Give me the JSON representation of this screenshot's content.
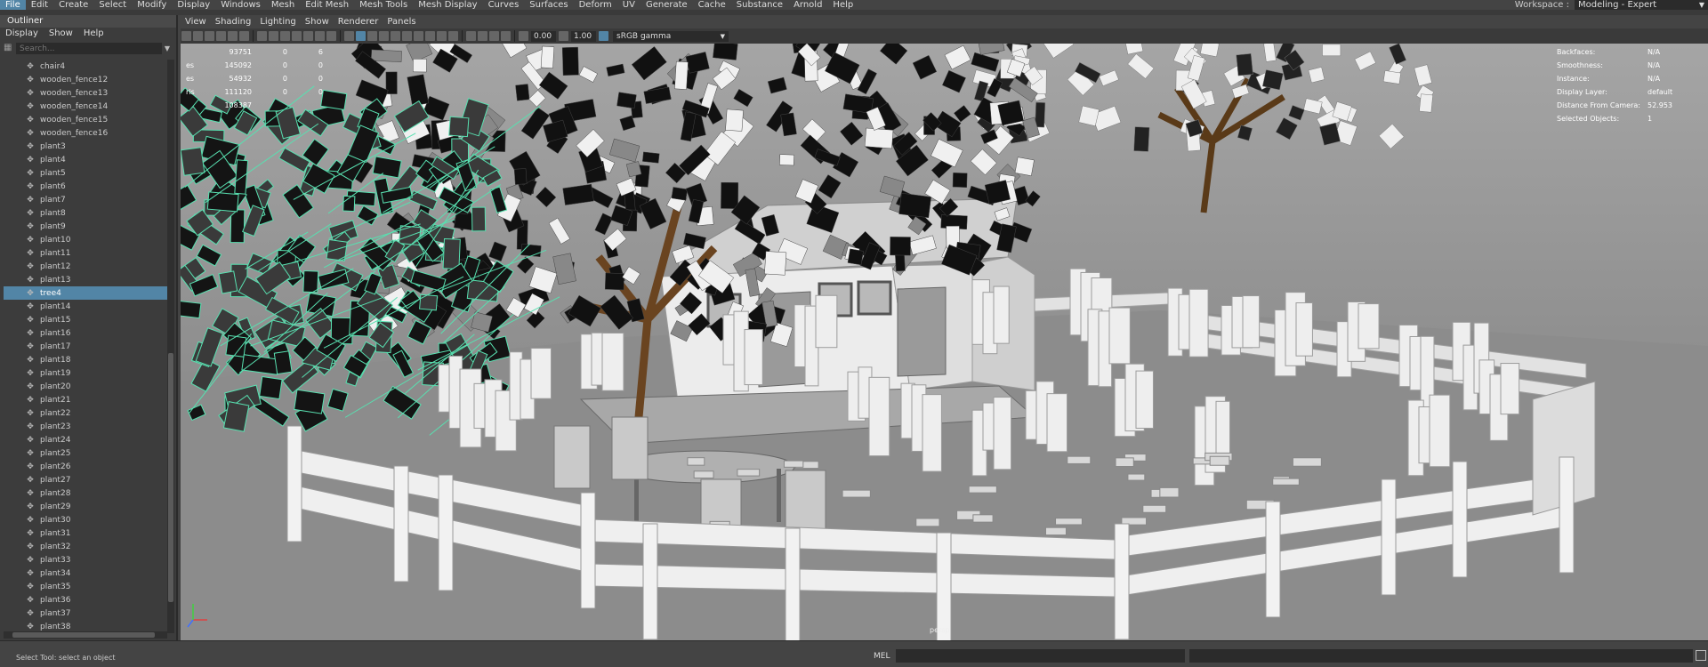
{
  "menubar": {
    "items": [
      "File",
      "Edit",
      "Create",
      "Select",
      "Modify",
      "Display",
      "Windows",
      "Mesh",
      "Edit Mesh",
      "Mesh Tools",
      "Mesh Display",
      "Curves",
      "Surfaces",
      "Deform",
      "UV",
      "Generate",
      "Cache",
      "Substance",
      "Arnold",
      "Help"
    ],
    "active": "File"
  },
  "workspace": {
    "label": "Workspace :",
    "value": "Modeling - Expert"
  },
  "outliner": {
    "title": "Outliner",
    "menu": [
      "Display",
      "Show",
      "Help"
    ],
    "search_placeholder": "Search...",
    "items": [
      {
        "name": "chair4",
        "selected": false
      },
      {
        "name": "wooden_fence12",
        "selected": false
      },
      {
        "name": "wooden_fence13",
        "selected": false
      },
      {
        "name": "wooden_fence14",
        "selected": false
      },
      {
        "name": "wooden_fence15",
        "selected": false
      },
      {
        "name": "wooden_fence16",
        "selected": false
      },
      {
        "name": "plant3",
        "selected": false
      },
      {
        "name": "plant4",
        "selected": false
      },
      {
        "name": "plant5",
        "selected": false
      },
      {
        "name": "plant6",
        "selected": false
      },
      {
        "name": "plant7",
        "selected": false
      },
      {
        "name": "plant8",
        "selected": false
      },
      {
        "name": "plant9",
        "selected": false
      },
      {
        "name": "plant10",
        "selected": false
      },
      {
        "name": "plant11",
        "selected": false
      },
      {
        "name": "plant12",
        "selected": false
      },
      {
        "name": "plant13",
        "selected": false
      },
      {
        "name": "tree4",
        "selected": true
      },
      {
        "name": "plant14",
        "selected": false
      },
      {
        "name": "plant15",
        "selected": false
      },
      {
        "name": "plant16",
        "selected": false
      },
      {
        "name": "plant17",
        "selected": false
      },
      {
        "name": "plant18",
        "selected": false
      },
      {
        "name": "plant19",
        "selected": false
      },
      {
        "name": "plant20",
        "selected": false
      },
      {
        "name": "plant21",
        "selected": false
      },
      {
        "name": "plant22",
        "selected": false
      },
      {
        "name": "plant23",
        "selected": false
      },
      {
        "name": "plant24",
        "selected": false
      },
      {
        "name": "plant25",
        "selected": false
      },
      {
        "name": "plant26",
        "selected": false
      },
      {
        "name": "plant27",
        "selected": false
      },
      {
        "name": "plant28",
        "selected": false
      },
      {
        "name": "plant29",
        "selected": false
      },
      {
        "name": "plant30",
        "selected": false
      },
      {
        "name": "plant31",
        "selected": false
      },
      {
        "name": "plant32",
        "selected": false
      },
      {
        "name": "plant33",
        "selected": false
      },
      {
        "name": "plant34",
        "selected": false
      },
      {
        "name": "plant35",
        "selected": false
      },
      {
        "name": "plant36",
        "selected": false
      },
      {
        "name": "plant37",
        "selected": false
      },
      {
        "name": "plant38",
        "selected": false
      }
    ]
  },
  "viewport": {
    "menu": [
      "View",
      "Shading",
      "Lighting",
      "Show",
      "Renderer",
      "Panels"
    ],
    "toolbar": {
      "exposure": "0.00",
      "gamma": "1.00",
      "color_space": "sRGB gamma"
    },
    "hud_left": [
      {
        "label": "",
        "v1": "93751",
        "v2": "0",
        "v3": "6"
      },
      {
        "label": "es",
        "v1": "145092",
        "v2": "0",
        "v3": "0"
      },
      {
        "label": "es",
        "v1": "54932",
        "v2": "0",
        "v3": "0"
      },
      {
        "label": "ris",
        "v1": "111120",
        "v2": "0",
        "v3": "0"
      },
      {
        "label": "",
        "v1": "108387",
        "v2": "",
        "v3": ""
      }
    ],
    "hud_right": [
      {
        "label": "Backfaces:",
        "value": "N/A"
      },
      {
        "label": "Smoothness:",
        "value": "N/A"
      },
      {
        "label": "Instance:",
        "value": "N/A"
      },
      {
        "label": "Display Layer:",
        "value": "default"
      },
      {
        "label": "Distance From Camera:",
        "value": "52.953"
      },
      {
        "label": "Selected Objects:",
        "value": "1"
      }
    ],
    "camera_label": "persp"
  },
  "statusbar": {
    "help": "Select Tool: select an object",
    "mel_label": "MEL"
  },
  "colors": {
    "accent": "#5285a6",
    "selection_wire": "#58e0b0"
  }
}
